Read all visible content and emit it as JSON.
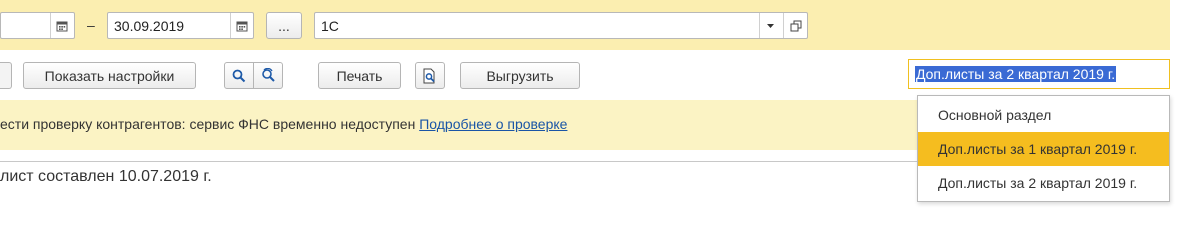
{
  "colors": {
    "period_bar_bg": "#fbeeb0",
    "info_bar_bg": "#fbf3c4",
    "selection_bg": "#3a6ad4",
    "dropdown_active_bg": "#f5bd1f",
    "link": "#1a55a6"
  },
  "period": {
    "from_value": "",
    "dash": "–",
    "to_value": "30.09.2019",
    "ellipsis_label": "...",
    "organization_value": "1С"
  },
  "toolbar": {
    "show_settings_label": "Показать настройки",
    "search_icon": "magnifier-icon",
    "refresh_search_icon": "search-refresh-icon",
    "print_label": "Печать",
    "preview_icon": "document-preview-icon",
    "export_label": "Выгрузить"
  },
  "section_select": {
    "value": "Доп.листы за 2 квартал 2019 г.",
    "options": [
      "Основной раздел",
      "Доп.листы за 1 квартал 2019 г.",
      "Доп.листы за 2 квартал 2019 г."
    ],
    "highlighted_option": "Доп.листы за 1 квартал 2019 г."
  },
  "info": {
    "message": "ести проверку контрагентов: сервис ФНС временно недоступен",
    "link_text": "Подробнее о проверке"
  },
  "body": {
    "text": "лист составлен 10.07.2019 г."
  }
}
